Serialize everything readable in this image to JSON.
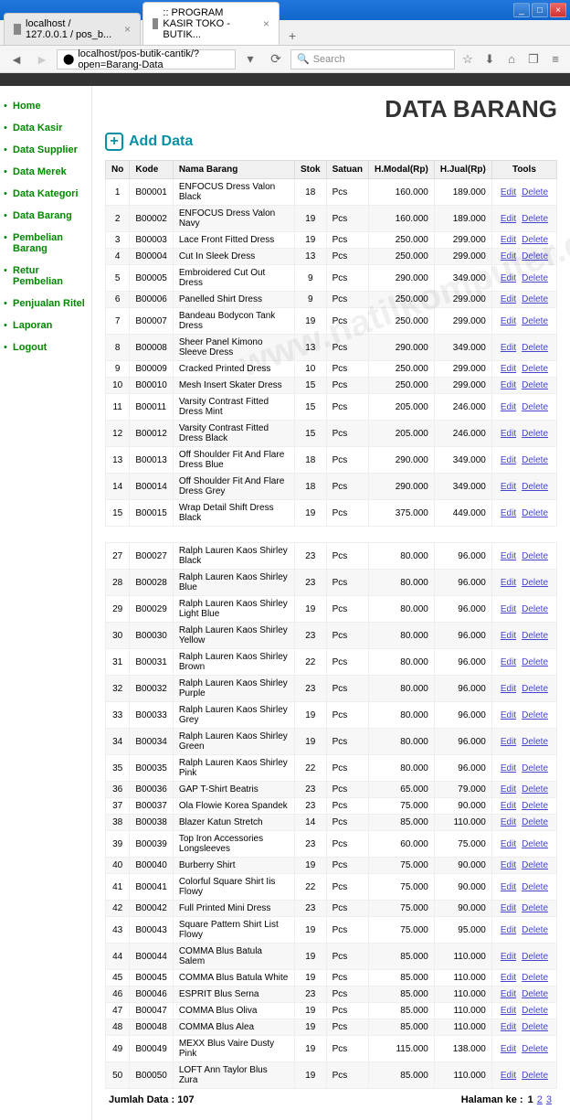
{
  "window": {
    "min": "_",
    "max": "□",
    "close": "×"
  },
  "tabs": [
    {
      "label": "localhost / 127.0.0.1 / pos_b..."
    },
    {
      "label": ":: PROGRAM KASIR TOKO - BUTIK..."
    }
  ],
  "address": {
    "url": "localhost/pos-butik-cantik/?open=Barang-Data",
    "search_placeholder": "Search"
  },
  "nav": {
    "items": [
      "Home",
      "Data Kasir",
      "Data Supplier",
      "Data Merek",
      "Data Kategori",
      "Data Barang",
      "Pembelian Barang",
      "Retur Pembelian",
      "Penjualan Ritel",
      "Laporan",
      "Logout"
    ]
  },
  "page": {
    "title": "DATA BARANG",
    "add_label": "Add Data",
    "headers": {
      "no": "No",
      "kode": "Kode",
      "nama": "Nama Barang",
      "stok": "Stok",
      "satuan": "Satuan",
      "modal": "H.Modal(Rp)",
      "jual": "H.Jual(Rp)",
      "tools": "Tools"
    },
    "edit": "Edit",
    "delete": "Delete",
    "total_label": "Jumlah Data :",
    "total": "107",
    "pager_label": "Halaman ke :",
    "pages": [
      "1",
      "2",
      "3"
    ]
  },
  "rows1": [
    {
      "no": 1,
      "kode": "B00001",
      "nama": "ENFOCUS Dress Valon Black",
      "stok": 18,
      "sat": "Pcs",
      "modal": "160.000",
      "jual": "189.000"
    },
    {
      "no": 2,
      "kode": "B00002",
      "nama": "ENFOCUS Dress Valon Navy",
      "stok": 19,
      "sat": "Pcs",
      "modal": "160.000",
      "jual": "189.000"
    },
    {
      "no": 3,
      "kode": "B00003",
      "nama": "Lace Front Fitted Dress",
      "stok": 19,
      "sat": "Pcs",
      "modal": "250.000",
      "jual": "299.000"
    },
    {
      "no": 4,
      "kode": "B00004",
      "nama": "Cut In Sleek Dress",
      "stok": 13,
      "sat": "Pcs",
      "modal": "250.000",
      "jual": "299.000"
    },
    {
      "no": 5,
      "kode": "B00005",
      "nama": "Embroidered Cut Out Dress",
      "stok": 9,
      "sat": "Pcs",
      "modal": "290.000",
      "jual": "349.000"
    },
    {
      "no": 6,
      "kode": "B00006",
      "nama": "Panelled Shirt Dress",
      "stok": 9,
      "sat": "Pcs",
      "modal": "250.000",
      "jual": "299.000"
    },
    {
      "no": 7,
      "kode": "B00007",
      "nama": "Bandeau Bodycon Tank Dress",
      "stok": 19,
      "sat": "Pcs",
      "modal": "250.000",
      "jual": "299.000"
    },
    {
      "no": 8,
      "kode": "B00008",
      "nama": "Sheer Panel Kimono Sleeve Dress",
      "stok": 13,
      "sat": "Pcs",
      "modal": "290.000",
      "jual": "349.000"
    },
    {
      "no": 9,
      "kode": "B00009",
      "nama": "Cracked Printed Dress",
      "stok": 10,
      "sat": "Pcs",
      "modal": "250.000",
      "jual": "299.000"
    },
    {
      "no": 10,
      "kode": "B00010",
      "nama": "Mesh Insert Skater Dress",
      "stok": 15,
      "sat": "Pcs",
      "modal": "250.000",
      "jual": "299.000"
    },
    {
      "no": 11,
      "kode": "B00011",
      "nama": "Varsity Contrast Fitted Dress Mint",
      "stok": 15,
      "sat": "Pcs",
      "modal": "205.000",
      "jual": "246.000"
    },
    {
      "no": 12,
      "kode": "B00012",
      "nama": "Varsity Contrast Fitted Dress Black",
      "stok": 15,
      "sat": "Pcs",
      "modal": "205.000",
      "jual": "246.000"
    },
    {
      "no": 13,
      "kode": "B00013",
      "nama": "Off Shoulder Fit And Flare Dress Blue",
      "stok": 18,
      "sat": "Pcs",
      "modal": "290.000",
      "jual": "349.000"
    },
    {
      "no": 14,
      "kode": "B00014",
      "nama": "Off Shoulder Fit And Flare Dress Grey",
      "stok": 18,
      "sat": "Pcs",
      "modal": "290.000",
      "jual": "349.000"
    },
    {
      "no": 15,
      "kode": "B00015",
      "nama": "Wrap Detail Shift Dress Black",
      "stok": 19,
      "sat": "Pcs",
      "modal": "375.000",
      "jual": "449.000"
    }
  ],
  "rows2": [
    {
      "no": 27,
      "kode": "B00027",
      "nama": "Ralph Lauren Kaos Shirley Black",
      "stok": 23,
      "sat": "Pcs",
      "modal": "80.000",
      "jual": "96.000"
    },
    {
      "no": 28,
      "kode": "B00028",
      "nama": "Ralph Lauren Kaos Shirley Blue",
      "stok": 23,
      "sat": "Pcs",
      "modal": "80.000",
      "jual": "96.000"
    },
    {
      "no": 29,
      "kode": "B00029",
      "nama": "Ralph Lauren Kaos Shirley Light Blue",
      "stok": 19,
      "sat": "Pcs",
      "modal": "80.000",
      "jual": "96.000"
    },
    {
      "no": 30,
      "kode": "B00030",
      "nama": "Ralph Lauren Kaos Shirley Yellow",
      "stok": 23,
      "sat": "Pcs",
      "modal": "80.000",
      "jual": "96.000"
    },
    {
      "no": 31,
      "kode": "B00031",
      "nama": "Ralph Lauren Kaos Shirley Brown",
      "stok": 22,
      "sat": "Pcs",
      "modal": "80.000",
      "jual": "96.000"
    },
    {
      "no": 32,
      "kode": "B00032",
      "nama": "Ralph Lauren Kaos Shirley Purple",
      "stok": 23,
      "sat": "Pcs",
      "modal": "80.000",
      "jual": "96.000"
    },
    {
      "no": 33,
      "kode": "B00033",
      "nama": "Ralph Lauren Kaos Shirley Grey",
      "stok": 19,
      "sat": "Pcs",
      "modal": "80.000",
      "jual": "96.000"
    },
    {
      "no": 34,
      "kode": "B00034",
      "nama": "Ralph Lauren Kaos Shirley Green",
      "stok": 19,
      "sat": "Pcs",
      "modal": "80.000",
      "jual": "96.000"
    },
    {
      "no": 35,
      "kode": "B00035",
      "nama": "Ralph Lauren Kaos Shirley Pink",
      "stok": 22,
      "sat": "Pcs",
      "modal": "80.000",
      "jual": "96.000"
    },
    {
      "no": 36,
      "kode": "B00036",
      "nama": "GAP T-Shirt Beatris",
      "stok": 23,
      "sat": "Pcs",
      "modal": "65.000",
      "jual": "79.000"
    },
    {
      "no": 37,
      "kode": "B00037",
      "nama": "Ola Flowie Korea Spandek",
      "stok": 23,
      "sat": "Pcs",
      "modal": "75.000",
      "jual": "90.000"
    },
    {
      "no": 38,
      "kode": "B00038",
      "nama": "Blazer Katun Stretch",
      "stok": 14,
      "sat": "Pcs",
      "modal": "85.000",
      "jual": "110.000"
    },
    {
      "no": 39,
      "kode": "B00039",
      "nama": "Top Iron Accessories Longsleeves",
      "stok": 23,
      "sat": "Pcs",
      "modal": "60.000",
      "jual": "75.000"
    },
    {
      "no": 40,
      "kode": "B00040",
      "nama": "Burberry Shirt",
      "stok": 19,
      "sat": "Pcs",
      "modal": "75.000",
      "jual": "90.000"
    },
    {
      "no": 41,
      "kode": "B00041",
      "nama": "Colorful Square Shirt Iis Flowy",
      "stok": 22,
      "sat": "Pcs",
      "modal": "75.000",
      "jual": "90.000"
    },
    {
      "no": 42,
      "kode": "B00042",
      "nama": "Full Printed Mini Dress",
      "stok": 23,
      "sat": "Pcs",
      "modal": "75.000",
      "jual": "90.000"
    },
    {
      "no": 43,
      "kode": "B00043",
      "nama": "Square Pattern Shirt List Flowy",
      "stok": 19,
      "sat": "Pcs",
      "modal": "75.000",
      "jual": "95.000"
    },
    {
      "no": 44,
      "kode": "B00044",
      "nama": "COMMA Blus Batula Salem",
      "stok": 19,
      "sat": "Pcs",
      "modal": "85.000",
      "jual": "110.000"
    },
    {
      "no": 45,
      "kode": "B00045",
      "nama": "COMMA Blus Batula White",
      "stok": 19,
      "sat": "Pcs",
      "modal": "85.000",
      "jual": "110.000"
    },
    {
      "no": 46,
      "kode": "B00046",
      "nama": "ESPRIT Blus Serna",
      "stok": 23,
      "sat": "Pcs",
      "modal": "85.000",
      "jual": "110.000"
    },
    {
      "no": 47,
      "kode": "B00047",
      "nama": "COMMA Blus Oliva",
      "stok": 19,
      "sat": "Pcs",
      "modal": "85.000",
      "jual": "110.000"
    },
    {
      "no": 48,
      "kode": "B00048",
      "nama": "COMMA Blus Alea",
      "stok": 19,
      "sat": "Pcs",
      "modal": "85.000",
      "jual": "110.000"
    },
    {
      "no": 49,
      "kode": "B00049",
      "nama": "MEXX Blus Vaire Dusty Pink",
      "stok": 19,
      "sat": "Pcs",
      "modal": "115.000",
      "jual": "138.000"
    },
    {
      "no": 50,
      "kode": "B00050",
      "nama": "LOFT Ann Taylor Blus Zura",
      "stok": 19,
      "sat": "Pcs",
      "modal": "85.000",
      "jual": "110.000"
    }
  ]
}
